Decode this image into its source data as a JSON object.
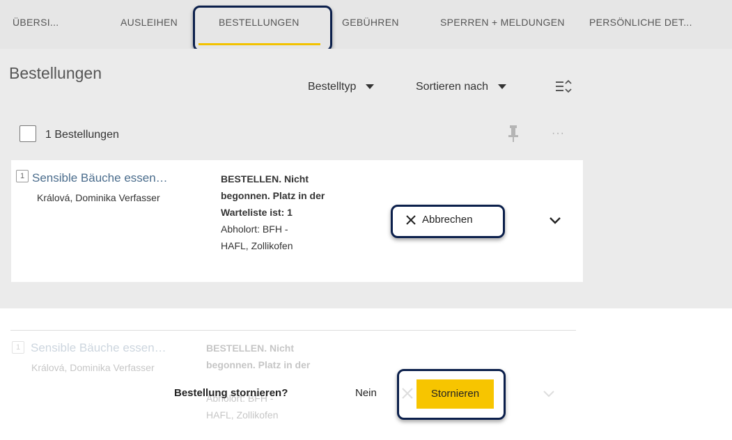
{
  "tabs": [
    {
      "label": "ÜBERSI..."
    },
    {
      "label": "AUSLEIHEN"
    },
    {
      "label": "BESTELLUNGEN",
      "active": true
    },
    {
      "label": "GEBÜHREN"
    },
    {
      "label": "SPERREN + MELDUNGEN"
    },
    {
      "label": "PERSÖNLICHE DET..."
    }
  ],
  "page_title": "Bestellungen",
  "filters": {
    "type_label": "Bestelltyp",
    "sort_label": "Sortieren nach"
  },
  "list_header": {
    "count_label": "1 Bestellungen"
  },
  "request": {
    "index": "1",
    "title": "Sensible Bäuche essen…",
    "author": "Králová, Dominika Verfasser",
    "status_lines": [
      "BESTELLEN. Nicht",
      "begonnen. Platz in der",
      "Warteliste ist: 1"
    ],
    "pickup_lines": [
      "Abholort: BFH -",
      "HAFL, Zollikofen"
    ],
    "cancel_label": "Abbrechen"
  },
  "confirm": {
    "question": "Bestellung stornieren?",
    "no_label": "Nein",
    "confirm_label": "Stornieren"
  },
  "colors": {
    "accent": "#f2c200",
    "highlight_border": "#0b1f4b",
    "link": "#4a6c8c",
    "confirm_button": "#f7c500"
  }
}
